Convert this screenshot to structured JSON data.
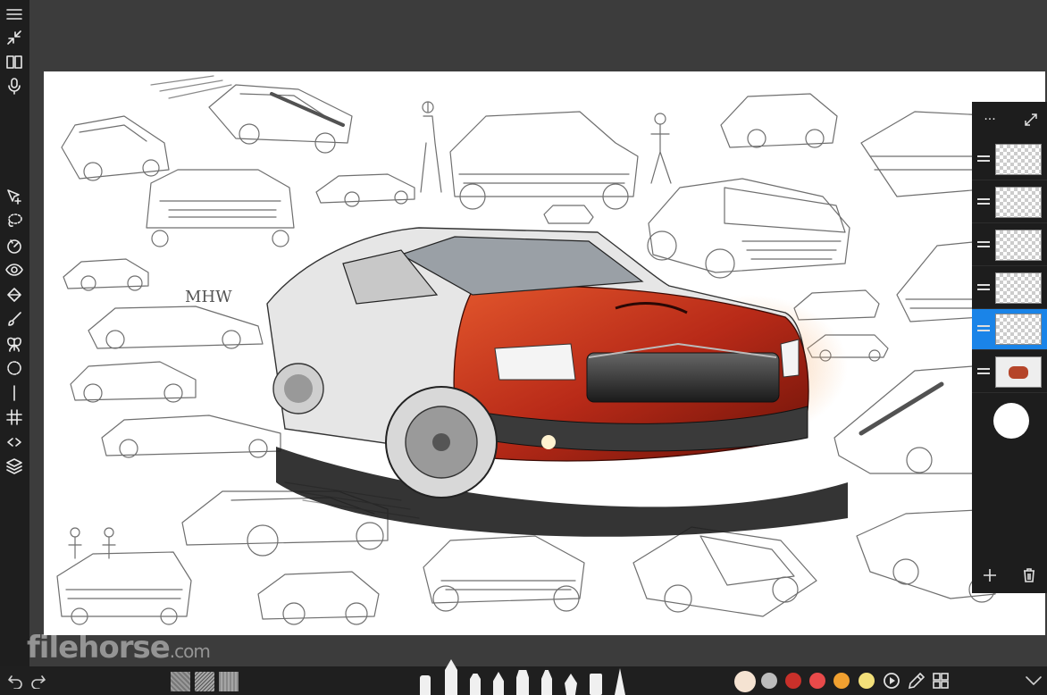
{
  "watermark": {
    "brand": "filehorse",
    "suffix": ".com"
  },
  "canvas": {
    "signature": "MHW"
  },
  "left_toolbar": {
    "tools": [
      "menu-icon",
      "shrink-icon",
      "book-icon",
      "mic-icon",
      "select-transform-icon",
      "lasso-icon",
      "ruler-icon",
      "eye-icon",
      "fill-icon",
      "brush-icon",
      "symmetry-icon",
      "guide-circle-icon",
      "line-icon",
      "grid-icon",
      "flip-icon",
      "layers-icon"
    ]
  },
  "layers_panel": {
    "more_label": "···",
    "layers": [
      {
        "name": "layer-1",
        "selected": false
      },
      {
        "name": "layer-2",
        "selected": false
      },
      {
        "name": "layer-3",
        "selected": false
      },
      {
        "name": "layer-4",
        "selected": false
      },
      {
        "name": "layer-5",
        "selected": true
      },
      {
        "name": "layer-6",
        "selected": false
      }
    ],
    "selected_color": "#ffffff"
  },
  "bottom_bar": {
    "colors": [
      "#f5e3d2",
      "#bcbcbc",
      "#c8302a",
      "#e84a4a",
      "#f0a030",
      "#f3e07a"
    ],
    "accent": "#1a84e8"
  }
}
